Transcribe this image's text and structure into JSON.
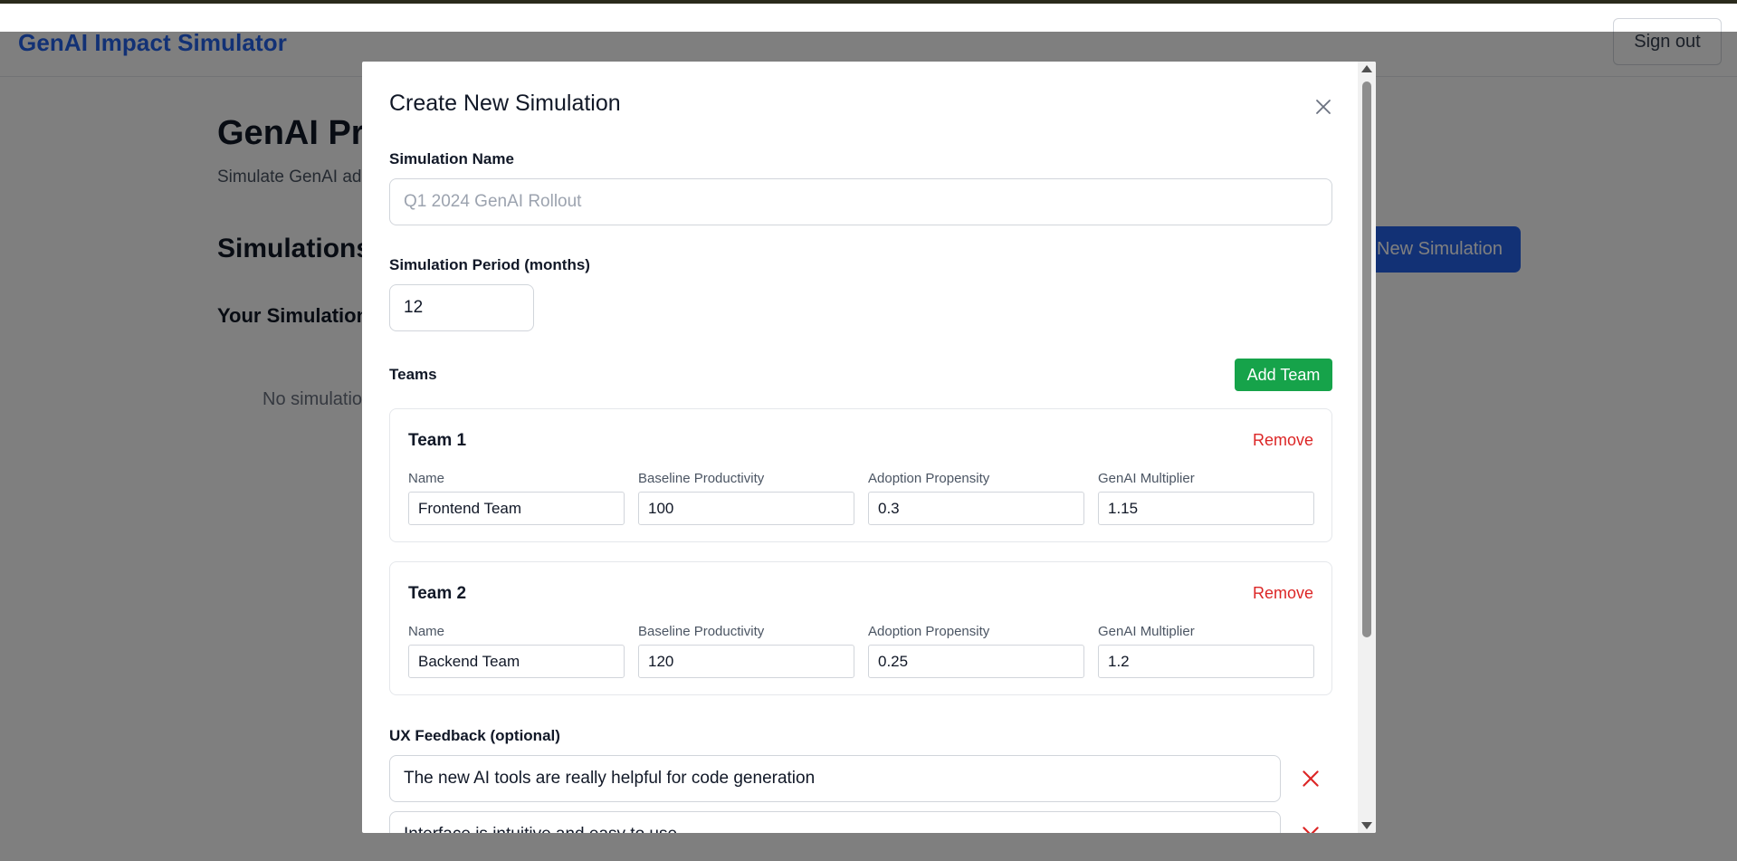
{
  "app": {
    "brand": "GenAI Impact Simulator",
    "sign_out_label": "Sign out",
    "page_title": "GenAI Pro",
    "page_subtitle": "Simulate GenAI ad",
    "simulations_heading": "Simulations",
    "new_simulation_label": "New Simulation",
    "your_simulations_heading": "Your Simulation",
    "empty_text": "No simulatio"
  },
  "modal": {
    "title": "Create New Simulation",
    "close_icon": "close-icon",
    "simulation_name": {
      "label": "Simulation Name",
      "placeholder": "Q1 2024 GenAI Rollout",
      "value": ""
    },
    "simulation_period": {
      "label": "Simulation Period (months)",
      "value": "12"
    },
    "teams_label": "Teams",
    "add_team_label": "Add Team",
    "remove_label": "Remove",
    "field_labels": {
      "name": "Name",
      "baseline": "Baseline Productivity",
      "adoption": "Adoption Propensity",
      "multiplier": "GenAI Multiplier"
    },
    "teams": [
      {
        "title": "Team 1",
        "name": "Frontend Team",
        "baseline": "100",
        "adoption": "0.3",
        "multiplier": "1.15"
      },
      {
        "title": "Team 2",
        "name": "Backend Team",
        "baseline": "120",
        "adoption": "0.25",
        "multiplier": "1.2"
      }
    ],
    "ux_feedback_label": "UX Feedback (optional)",
    "feedback": [
      "The new AI tools are really helpful for code generation",
      "Interface is intuitive and easy to use"
    ]
  },
  "colors": {
    "brand": "#2563eb",
    "success": "#16a34a",
    "danger": "#dc2626",
    "overlay": "rgba(0,0,0,0.5)"
  }
}
